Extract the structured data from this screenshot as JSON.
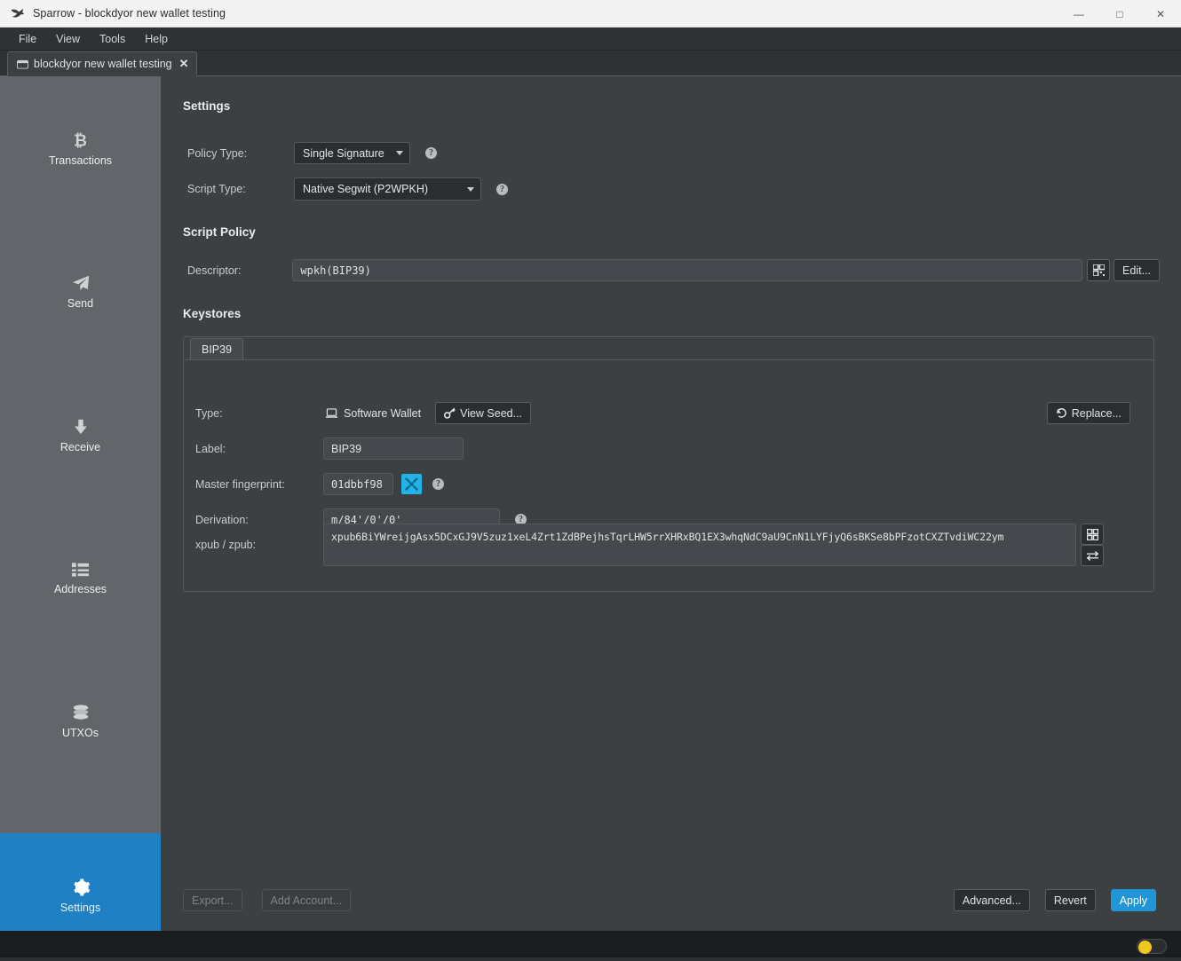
{
  "window": {
    "title": "Sparrow - blockdyor new wallet testing",
    "app_icon": "sparrow-bird-icon",
    "controls": {
      "minimize": "—",
      "maximize": "□",
      "close": "✕"
    }
  },
  "menubar": {
    "items": [
      "File",
      "View",
      "Tools",
      "Help"
    ]
  },
  "wallet_tabs": [
    {
      "label": "blockdyor new wallet testing",
      "icon": "wallet-icon",
      "close": "✕",
      "active": true
    }
  ],
  "sidebar": {
    "items": [
      {
        "label": "Transactions",
        "icon": "bitcoin-icon",
        "active": false
      },
      {
        "label": "Send",
        "icon": "send-paper-plane-icon",
        "active": false
      },
      {
        "label": "Receive",
        "icon": "download-arrow-icon",
        "active": false
      },
      {
        "label": "Addresses",
        "icon": "address-list-icon",
        "active": false
      },
      {
        "label": "UTXOs",
        "icon": "coins-stack-icon",
        "active": false
      },
      {
        "label": "Settings",
        "icon": "gear-icon",
        "active": true
      }
    ],
    "active_color": "#1f80c4",
    "background": "#626569"
  },
  "settings": {
    "heading": "Settings",
    "policy_type": {
      "label": "Policy Type:",
      "value": "Single Signature",
      "help": "?"
    },
    "script_type": {
      "label": "Script Type:",
      "value": "Native Segwit (P2WPKH)",
      "help": "?"
    }
  },
  "script_policy": {
    "heading": "Script Policy",
    "descriptor": {
      "label": "Descriptor:",
      "value": "wpkh(BIP39)",
      "qr_button": "qr-code-icon",
      "edit_button": "Edit..."
    }
  },
  "keystores": {
    "heading": "Keystores",
    "tabs": [
      {
        "label": "BIP39",
        "active": true
      }
    ],
    "type": {
      "label": "Type:",
      "value": "Software Wallet",
      "value_icon": "laptop-icon",
      "view_seed_button": "View Seed...",
      "view_seed_icon": "key-icon",
      "replace_button": "Replace...",
      "replace_icon": "undo-arrow-icon"
    },
    "label_field": {
      "label": "Label:",
      "value": "BIP39"
    },
    "master_fingerprint": {
      "label": "Master fingerprint:",
      "value": "01dbbf98",
      "swatch_icon": "identicon-swatch",
      "swatch_color": "#23b3e8",
      "help": "?"
    },
    "derivation": {
      "label": "Derivation:",
      "value": "m/84'/0'/0'",
      "help": "?"
    },
    "xpub": {
      "label": "xpub / zpub:",
      "value": "xpub6BiYWreijgAsx5DCxGJ9V5zuz1xeL4Zrt1ZdBPejhsTqrLHW5rrXHRxBQ1EX3whqNdC9aU9CnN1LYFjyQ6sBKSe8bPFzotCXZTvdiWC22ym",
      "qr_button": "qr-code-icon",
      "swap_button": "swap-arrows-icon"
    }
  },
  "footer": {
    "export_button": "Export...",
    "add_account_button": "Add Account...",
    "advanced_button": "Advanced...",
    "revert_button": "Revert",
    "apply_button": "Apply",
    "apply_color": "#2196d6"
  },
  "statusbar": {
    "theme_toggle": "theme-toggle",
    "toggle_color": "#f2c71c"
  }
}
